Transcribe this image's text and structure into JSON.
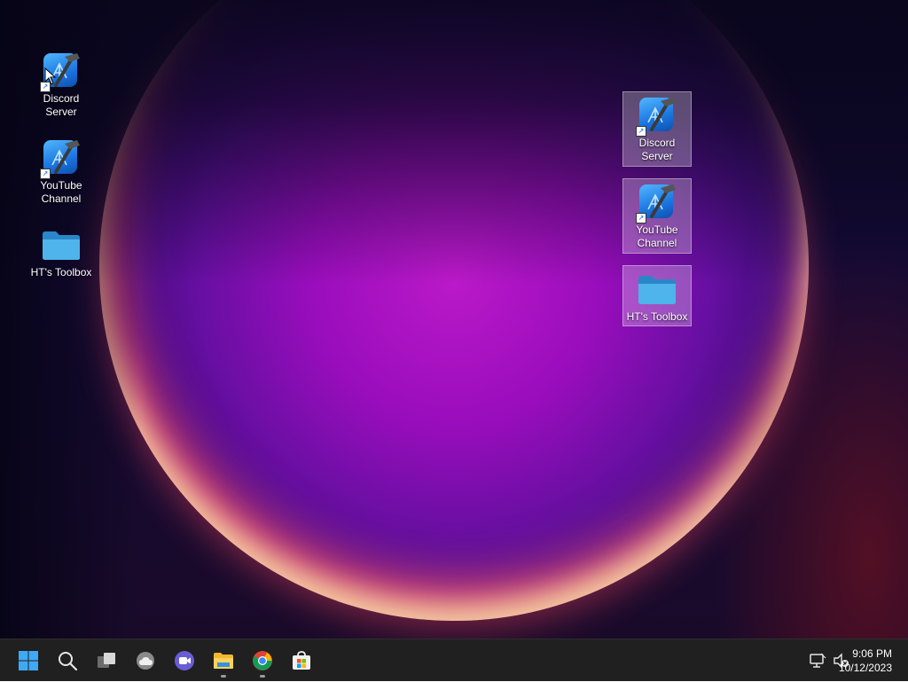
{
  "desktop": {
    "left_icons": [
      {
        "label": "Discord Server",
        "type": "shortcut"
      },
      {
        "label": "YouTube Channel",
        "type": "shortcut"
      },
      {
        "label": "HT's Toolbox",
        "type": "folder"
      }
    ],
    "right_icons": [
      {
        "label": "Discord Server",
        "type": "shortcut"
      },
      {
        "label": "YouTube Channel",
        "type": "shortcut"
      },
      {
        "label": "HT's Toolbox",
        "type": "folder"
      }
    ]
  },
  "taskbar": {
    "buttons": [
      {
        "name": "start-button",
        "icon": "windows-logo-icon"
      },
      {
        "name": "search-button",
        "icon": "search-icon"
      },
      {
        "name": "task-view-button",
        "icon": "task-view-icon"
      },
      {
        "name": "widgets-button",
        "icon": "weather-icon"
      },
      {
        "name": "chat-button",
        "icon": "video-chat-icon"
      },
      {
        "name": "file-explorer-button",
        "icon": "folder-icon",
        "running": true
      },
      {
        "name": "chrome-button",
        "icon": "chrome-icon",
        "running": true
      },
      {
        "name": "store-button",
        "icon": "store-icon"
      }
    ],
    "clock": {
      "time": "9:06 PM",
      "date": "10/12/2023"
    }
  },
  "colors": {
    "taskbar_bg": "#202020",
    "accent": "#1b76e0",
    "folder": "#3aa0e0"
  }
}
